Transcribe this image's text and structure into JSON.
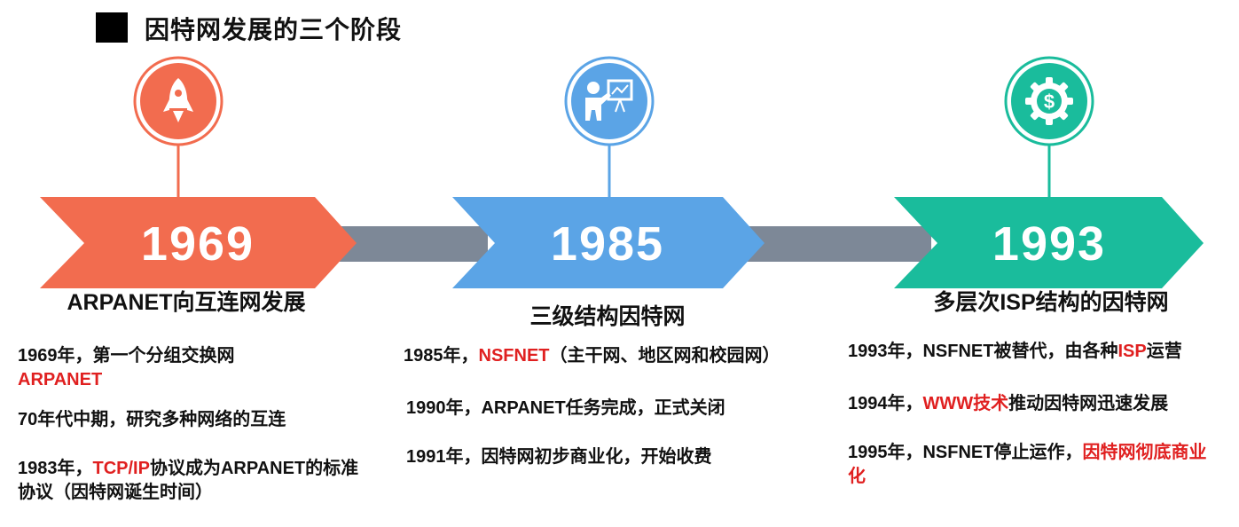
{
  "title": "因特网发展的三个阶段",
  "colors": {
    "stage1": "#f26c4f",
    "stage2": "#5ba4e6",
    "stage3": "#1abc9c",
    "connector": "#7d8897",
    "highlight": "#e02020"
  },
  "stages": [
    {
      "year": "1969",
      "icon": "rocket-icon",
      "title": "ARPANET向互连网发展",
      "items": [
        {
          "parts": [
            {
              "text": "1969年，第一个分组交换网"
            },
            {
              "text": "ARPANET",
              "red": true
            }
          ]
        },
        {
          "parts": [
            {
              "text": "70年代中期，研究多种网络的互连"
            }
          ]
        },
        {
          "parts": [
            {
              "text": "1983年，"
            },
            {
              "text": "TCP/IP",
              "red": true
            },
            {
              "text": "协议成为ARPANET的标准协议（因特网诞生时间）"
            }
          ]
        }
      ]
    },
    {
      "year": "1985",
      "icon": "presenter-board-icon",
      "title": "三级结构因特网",
      "items": [
        {
          "parts": [
            {
              "text": "1985年，"
            },
            {
              "text": "NSFNET",
              "red": true
            },
            {
              "text": "（主干网、地区网和校园网）"
            }
          ]
        },
        {
          "parts": [
            {
              "text": "1990年，ARPANET任务完成，正式关闭"
            }
          ]
        },
        {
          "parts": [
            {
              "text": "1991年，因特网初步商业化，开始收费"
            }
          ]
        }
      ]
    },
    {
      "year": "1993",
      "icon": "dollar-gear-icon",
      "title": "多层次ISP结构的因特网",
      "items": [
        {
          "parts": [
            {
              "text": "1993年，NSFNET被替代，由各种"
            },
            {
              "text": "ISP",
              "red": true
            },
            {
              "text": "运营"
            }
          ]
        },
        {
          "parts": [
            {
              "text": "1994年，"
            },
            {
              "text": "WWW技术",
              "red": true
            },
            {
              "text": "推动因特网迅速发展"
            }
          ]
        },
        {
          "parts": [
            {
              "text": "1995年，NSFNET停止运作，"
            },
            {
              "text": "因特网彻底商业化",
              "red": true
            }
          ]
        }
      ]
    }
  ]
}
